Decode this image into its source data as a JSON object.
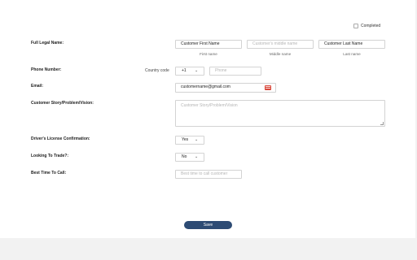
{
  "header": {
    "completed_label": "Completed",
    "completed_checked": false
  },
  "name": {
    "label": "Full Legal Name:",
    "first_value": "Customer First Name",
    "first_caption": "First name",
    "middle_placeholder": "Customer's middle name",
    "middle_caption": "Middle name",
    "last_value": "Customer Last Name",
    "last_caption": "Last name"
  },
  "phone": {
    "label": "Phone Number:",
    "country_code_label": "Country code",
    "country_code_value": "+1",
    "phone_placeholder": "Phone"
  },
  "email": {
    "label": "Email:",
    "value": "customername@gmail.com"
  },
  "story": {
    "label": "Customer Story/Problem/Vision:",
    "placeholder": "Customer Story/Problem/Vision"
  },
  "license": {
    "label": "Driver's License Confirmation:",
    "value": "Yes"
  },
  "trade": {
    "label": "Looking To Trade?:",
    "value": "No"
  },
  "best_time": {
    "label": "Best Time To Call:",
    "placeholder": "Best time to call customer"
  },
  "save_label": "Save",
  "icons": {
    "chevron": "chevron-down-icon",
    "contact": "contact-card-icon",
    "resize": "resize-handle-icon"
  }
}
